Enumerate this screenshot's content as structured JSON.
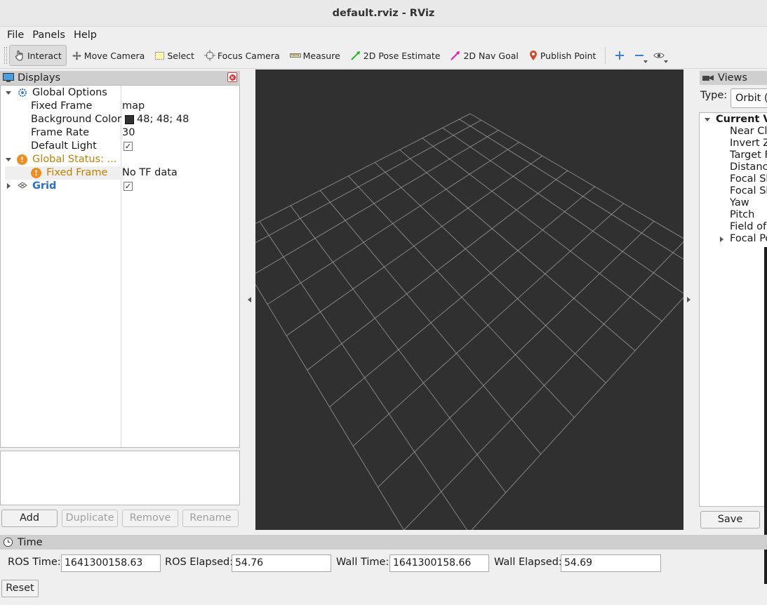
{
  "window": {
    "title": "default.rviz - RViz"
  },
  "menu": [
    "File",
    "Panels",
    "Help"
  ],
  "toolbar": {
    "interact": "Interact",
    "move_camera": "Move Camera",
    "select": "Select",
    "focus_camera": "Focus Camera",
    "measure": "Measure",
    "pose_estimate": "2D Pose Estimate",
    "nav_goal": "2D Nav Goal",
    "publish_point": "Publish Point",
    "add_tool_icon": "plus-icon",
    "remove_tool_icon": "minus-icon",
    "view_icon": "eye-icon"
  },
  "displays": {
    "title": "Displays",
    "global_options": "Global Options",
    "fixed_frame_label": "Fixed Frame",
    "fixed_frame_value": "map",
    "bg_color_label": "Background Color",
    "bg_color_value": "48; 48; 48",
    "bg_color_hex": "#303030",
    "frame_rate_label": "Frame Rate",
    "frame_rate_value": "30",
    "default_light_label": "Default Light",
    "default_light_checked": true,
    "global_status_label": "Global Status: ...",
    "status_fixed_frame_label": "Fixed Frame",
    "status_fixed_frame_value": "No TF data",
    "grid_label": "Grid",
    "grid_checked": true,
    "buttons": {
      "add": "Add",
      "duplicate": "Duplicate",
      "remove": "Remove",
      "rename": "Rename"
    }
  },
  "views": {
    "title": "Views",
    "type_label": "Type:",
    "type_value": "Orbit (r",
    "current_view": "Current Vi",
    "items": [
      "Near Cli",
      "Invert Z",
      "Target F",
      "Distance",
      "Focal Sh",
      "Focal Sh",
      "Yaw",
      "Pitch",
      "Field of",
      "Focal Po"
    ],
    "save": "Save"
  },
  "time": {
    "title": "Time",
    "ros_time_label": "ROS Time:",
    "ros_time": "1641300158.63",
    "ros_elapsed_label": "ROS Elapsed:",
    "ros_elapsed": "54.76",
    "wall_time_label": "Wall Time:",
    "wall_time": "1641300158.66",
    "wall_elapsed_label": "Wall Elapsed:",
    "wall_elapsed": "54.69",
    "reset": "Reset"
  },
  "colors": {
    "viewport_bg": "#303030",
    "grid_line": "#a0a0a0",
    "warning": "#ef8d1e",
    "grid_label": "#2a6fd0"
  }
}
